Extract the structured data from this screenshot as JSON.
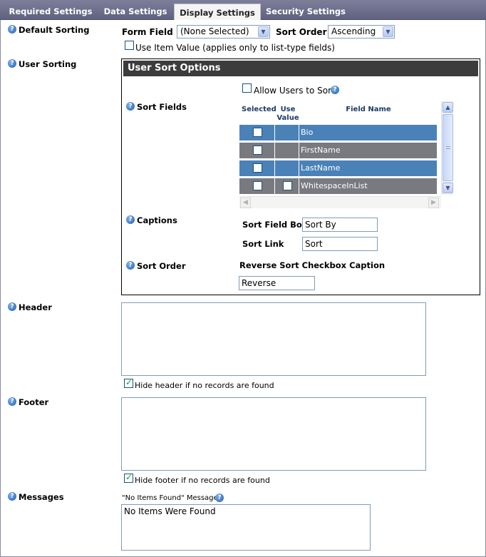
{
  "tabs": [
    {
      "label": "Required Settings"
    },
    {
      "label": "Data Settings"
    },
    {
      "label": "Display Settings"
    },
    {
      "label": "Security Settings"
    }
  ],
  "default_sorting": {
    "label": "Default Sorting",
    "form_field_label": "Form Field",
    "form_field_value": "(None Selected)",
    "sort_order_label": "Sort Order",
    "sort_order_value": "Ascending",
    "use_item_value_label": "Use Item Value (applies only to list-type fields)"
  },
  "user_sorting": {
    "label": "User Sorting",
    "box_title": "User Sort Options",
    "allow_users_label": "Allow Users to Sort",
    "sort_fields_label": "Sort Fields",
    "grid": {
      "headers": {
        "selected": "Selected",
        "use_value_1": "Use",
        "use_value_2": "Value",
        "field_name": "Field Name"
      },
      "rows": [
        {
          "name": "Bio",
          "has_use_value": false
        },
        {
          "name": "FirstName",
          "has_use_value": false
        },
        {
          "name": "LastName",
          "has_use_value": false
        },
        {
          "name": "WhitespaceInList",
          "has_use_value": true
        }
      ]
    },
    "captions_label": "Captions",
    "sort_field_box_label": "Sort Field Box",
    "sort_field_box_value": "Sort By",
    "sort_link_label": "Sort Link",
    "sort_link_value": "Sort",
    "sort_order_label": "Sort Order",
    "reverse_caption_label": "Reverse Sort Checkbox Caption",
    "reverse_caption_value": "Reverse"
  },
  "header": {
    "label": "Header",
    "hide_label": "Hide header if no records are found"
  },
  "footer": {
    "label": "Footer",
    "hide_label": "Hide footer if no records are found"
  },
  "messages": {
    "label": "Messages",
    "no_items_label": "\"No Items Found\" Message",
    "no_items_value": "No Items Were Found"
  },
  "icons": {
    "help": "help-icon"
  }
}
